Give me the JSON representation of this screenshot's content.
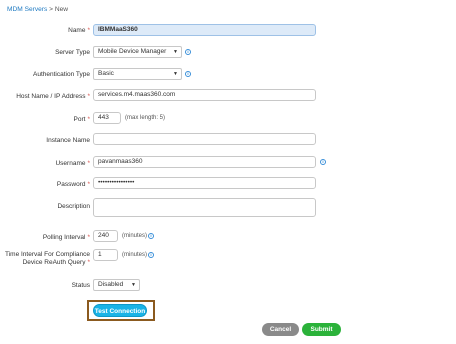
{
  "breadcrumb": {
    "parent": "MDM Servers",
    "separator": ">",
    "current": "New"
  },
  "form": {
    "name": {
      "label": "Name",
      "value": "IBMMaaS360"
    },
    "server_type": {
      "label": "Server Type",
      "value": "Mobile Device Manager"
    },
    "auth_type": {
      "label": "Authentication Type",
      "value": "Basic"
    },
    "host": {
      "label": "Host Name / IP Address",
      "value": "services.m4.maas360.com"
    },
    "port": {
      "label": "Port",
      "value": "443",
      "hint": "(max length: 5)"
    },
    "instance": {
      "label": "Instance Name",
      "value": ""
    },
    "username": {
      "label": "Username",
      "value": "pavanmaas360"
    },
    "password": {
      "label": "Password",
      "value": "••••••••••••••••"
    },
    "description": {
      "label": "Description",
      "value": ""
    },
    "polling": {
      "label": "Polling Interval",
      "value": "240",
      "unit": "(minutes)"
    },
    "reauth": {
      "label_line1": "Time Interval For Compliance",
      "label_line2": "Device ReAuth Query",
      "value": "1",
      "unit": "(minutes)"
    },
    "status": {
      "label": "Status",
      "value": "Disabled"
    }
  },
  "buttons": {
    "test_connection": "Test Connection",
    "cancel": "Cancel",
    "submit": "Submit"
  },
  "icons": {
    "info": "info-icon",
    "caret": "chevron-down-icon"
  },
  "colors": {
    "link": "#1f7ac2",
    "required": "#d9534f",
    "test_button": "#1ab3e6",
    "cancel": "#8a8a8a",
    "submit": "#2bb23a",
    "highlight": "#8b5a1f"
  }
}
